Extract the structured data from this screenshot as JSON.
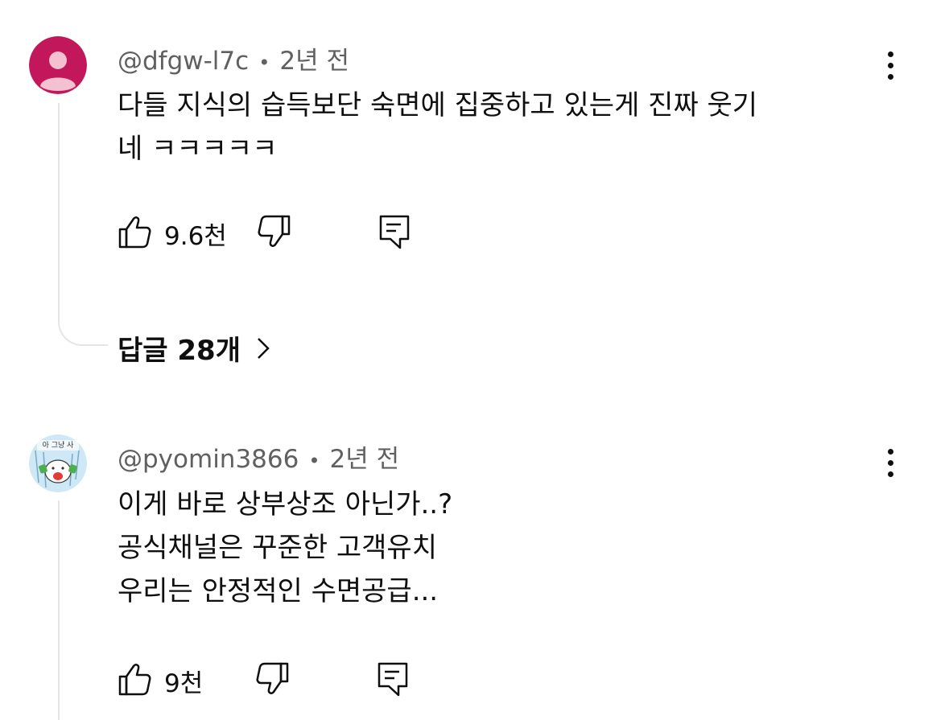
{
  "comments": [
    {
      "author": "@dfgw-l7c",
      "time": "2년 전",
      "lines": [
        "다들 지식의 습득보단 숙면에 집중하고 있는게 진짜 웃기",
        "네 ㅋㅋㅋㅋㅋ"
      ],
      "likes": "9.6천",
      "replies_label": "답글 28개",
      "avatar_color": "#c2185b"
    },
    {
      "author": "@pyomin3866",
      "time": "2년 전",
      "lines": [
        "이게 바로 상부상조 아닌가..?",
        "공식채널은 꾸준한 고객유치",
        "우리는 안정적인 수면공급..."
      ],
      "likes": "9천",
      "avatar_text": "아 그냥 사"
    }
  ],
  "icons": [
    "thumbs-up-icon",
    "thumbs-down-icon",
    "reply-icon",
    "more-vert-icon",
    "chevron-right-icon"
  ]
}
